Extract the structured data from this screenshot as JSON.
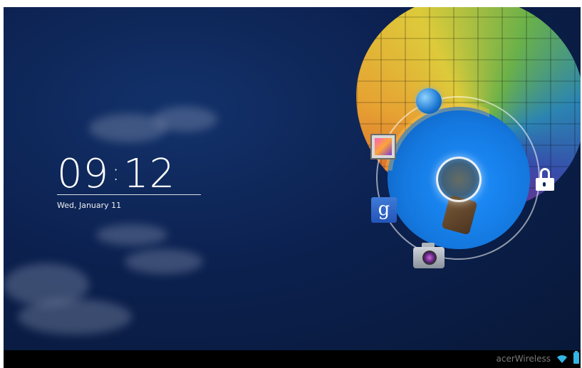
{
  "lockscreen": {
    "time_hours": "09",
    "time_separator": ":",
    "time_minutes": "12",
    "date": "Wed, January 11"
  },
  "shortcuts": [
    {
      "name": "browser",
      "icon": "globe-icon"
    },
    {
      "name": "gallery",
      "icon": "gallery-icon"
    },
    {
      "name": "google search",
      "icon": "google-icon",
      "glyph": "g"
    },
    {
      "name": "camera",
      "icon": "camera-icon"
    },
    {
      "name": "unlock",
      "icon": "unlock-icon"
    }
  ],
  "statusbar": {
    "network_name": "acerWireless",
    "wifi_icon": "wifi-icon",
    "battery_icon": "battery-icon"
  },
  "colors": {
    "background": "#0c2150",
    "ring_fill": "#1479e0",
    "statusbar_bg": "#000000",
    "battery": "#33b5e5"
  }
}
